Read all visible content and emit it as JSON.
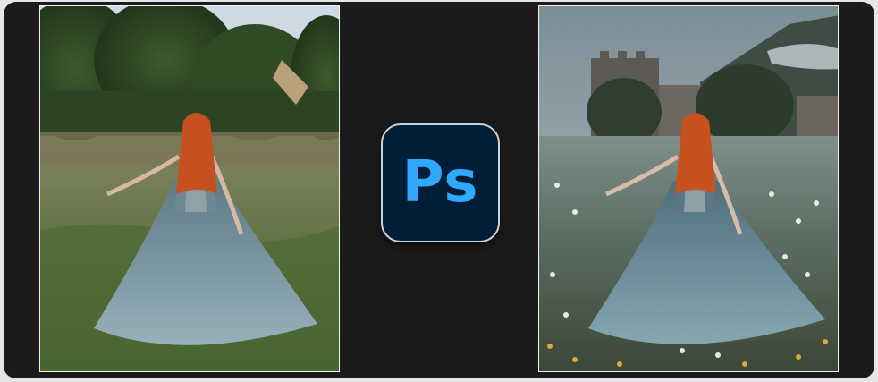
{
  "logo": {
    "text": "Ps",
    "icon": "photoshop-icon",
    "tile_color": "#001e36",
    "text_color": "#31a8ff"
  },
  "photos": {
    "before": {
      "content": "woman-in-gown-grass-field"
    },
    "after": {
      "content": "woman-in-gown-castle-flower-field"
    }
  }
}
